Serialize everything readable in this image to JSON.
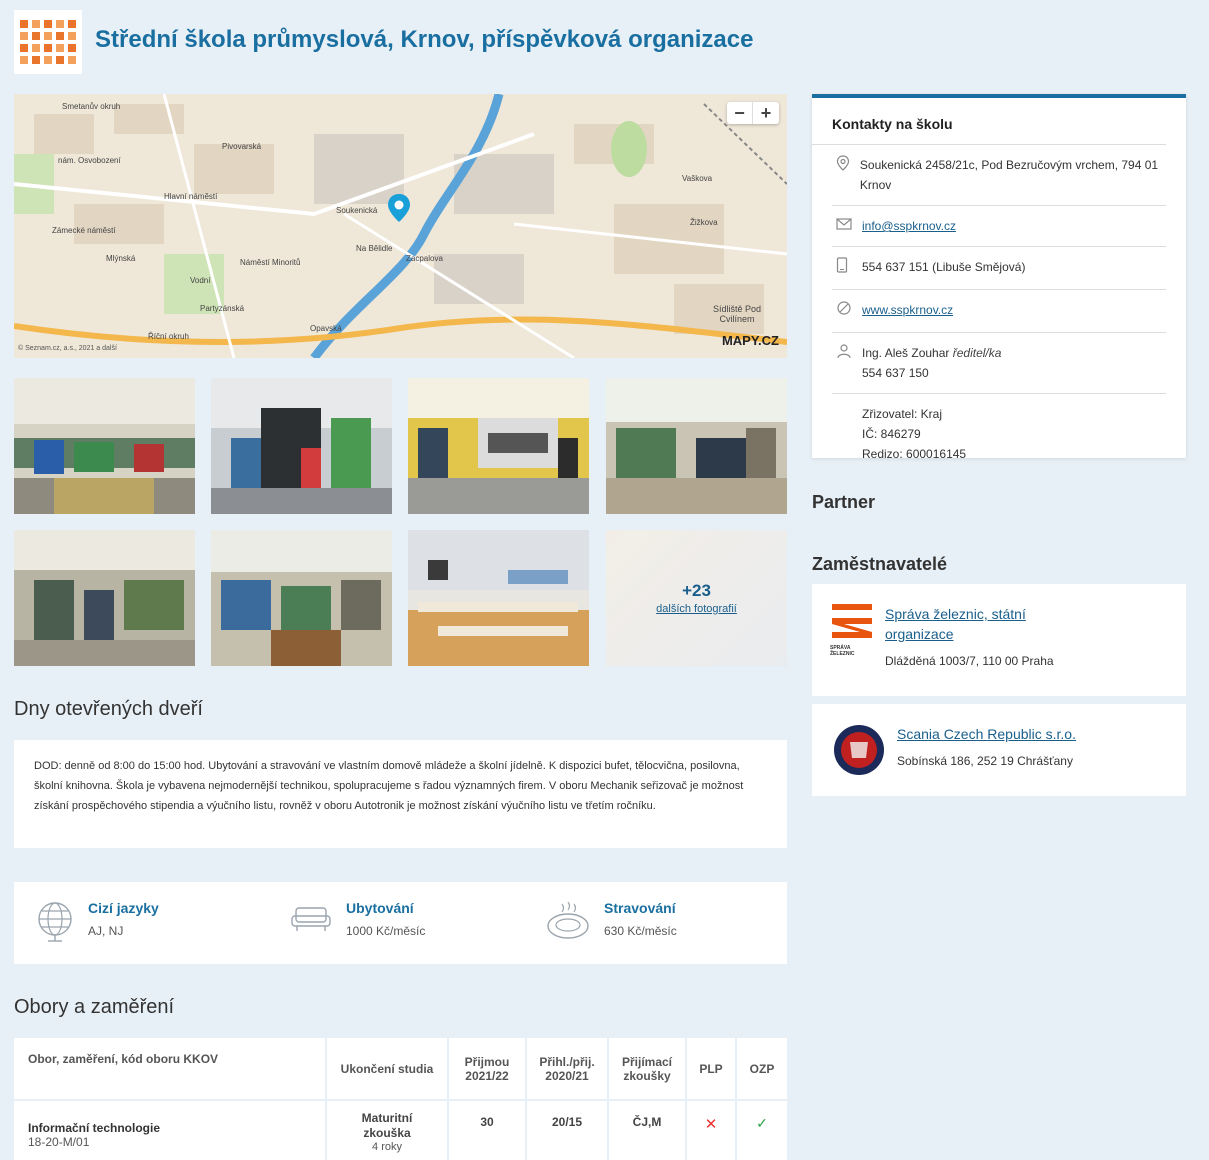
{
  "header": {
    "title": "Střední škola průmyslová, Krnov, příspěvková organizace"
  },
  "map": {
    "zoom_out": "−",
    "zoom_in": "+",
    "labels": [
      "Smetanův okruh",
      "Pivovarská",
      "Hlavní náměstí",
      "Zámecké náměstí",
      "nám. Osvobození",
      "Soukenická",
      "Na Bělidle",
      "Opavská",
      "Žižkova",
      "Vaškova",
      "Sídliště Pod Cvilínem",
      "Říční okruh",
      "Mlýnská",
      "Vodní",
      "Partyzánská",
      "Zacpalova",
      "Náměstí Minoritů"
    ],
    "copyright": "© Seznam.cz, a.s., 2021 a další",
    "logo_text": "MAPY.CZ"
  },
  "gallery": {
    "more_count": "+23",
    "more_label": "dalších fotografií"
  },
  "open_days": {
    "heading": "Dny otevřených dveří",
    "text": "DOD: denně od 8:00 do 15:00 hod. Ubytování a stravování ve vlastním domově mládeže a školní jídelně. K dispozici bufet, tělocvična, posilovna, školní knihovna. Škola je vybavena nejmodernější technikou, spolupracujeme s řadou významných firem. V oboru Mechanik seřizovač je možnost získání prospěchového stipendia a výučního listu, rovněž v oboru Autotronik je možnost získání výučního listu ve třetím ročníku."
  },
  "features": [
    {
      "label": "Cizí jazyky",
      "value": "AJ, NJ",
      "icon": "globe-icon"
    },
    {
      "label": "Ubytování",
      "value": "1000  Kč/měsíc",
      "icon": "sofa-icon"
    },
    {
      "label": "Stravování",
      "value": "630 Kč/měsíc",
      "icon": "plate-icon"
    }
  ],
  "fields": {
    "heading": "Obory a zaměření",
    "columns": [
      "Obor, zaměření, kód oboru KKOV",
      "Ukončení studia",
      "Přijmou 2021/22",
      "Přihl./přij. 2020/21",
      "Přijímací zkoušky",
      "PLP",
      "OZP"
    ],
    "rows": [
      {
        "name": "Informační technologie",
        "code": "18-20-M/01",
        "end": "Maturitní zkouška",
        "years": "4 roky",
        "accept": "30",
        "ratio": "20/15",
        "exams": "ČJ,M",
        "plp": "✕",
        "ozp": "✓"
      }
    ]
  },
  "contacts": {
    "heading": "Kontakty na školu",
    "address": "Soukenická 2458/21c, Pod Bezručovým vrchem, 794 01 Krnov",
    "email": "info@sspkrnov.cz",
    "phone": "554 637 151 (Libuše Smějová)",
    "web": "www.sspkrnov.cz",
    "director_name": "Ing. Aleš Zouhar",
    "director_role": "ředitel/ka",
    "director_phone": "554 637 150",
    "founder": "Zřizovatel: Kraj",
    "ic": "IČ: 846279",
    "redizo": "Redizo: 600016145"
  },
  "partner": {
    "heading": "Partner"
  },
  "employers": {
    "heading": "Zaměstnavatelé",
    "items": [
      {
        "name_line1": "Správa železnic, státní",
        "name_line2": "organizace",
        "address": "Dlážděná 1003/7, 110 00 Praha",
        "logo_text": "SPRÁVA ŽELEZNIC"
      },
      {
        "name_line1": "Scania Czech Republic s.r.o.",
        "address": "Sobínská 186, 252 19 Chrášťany"
      }
    ]
  },
  "colors": {
    "accent": "#1a6fa1",
    "link": "#1a5f8c",
    "background": "#e8f0f7",
    "logo_orange": "#e8752b"
  }
}
